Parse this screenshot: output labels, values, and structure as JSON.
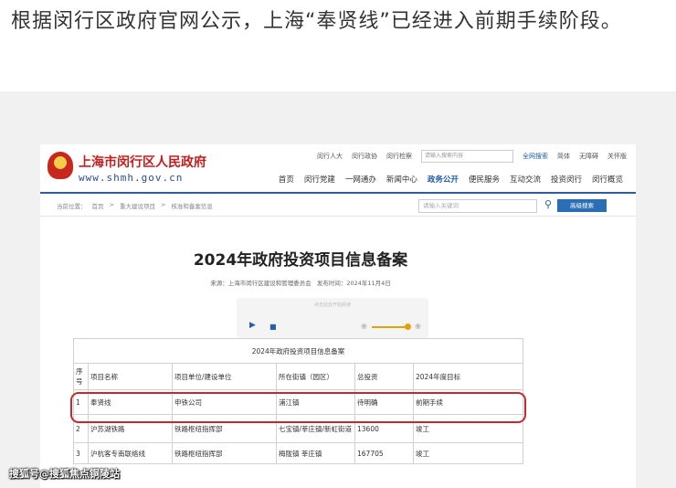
{
  "caption": "根据闵行区政府官网公示，上海“奉贤线”已经进入前期手续阶段。",
  "site": {
    "name": "上海市闵行区人民政府",
    "url": "www.shmh.gov.cn",
    "top_links": [
      "闵行人大",
      "闵行政协",
      "闵行检察"
    ],
    "top_search_label": "请输入搜索内容",
    "full_search": "全网搜索",
    "lang": "简体",
    "accessible": "无障碍",
    "care": "关怀版"
  },
  "nav": [
    "首页",
    "闵行党建",
    "一网通办",
    "新闻中心",
    "政务公开",
    "便民服务",
    "互动交流",
    "投资闵行",
    "闵行概览"
  ],
  "nav_active": "政务公开",
  "breadcrumb": [
    "当前位置：",
    "首页",
    ">",
    "重大建设项目",
    ">",
    "核准和备案信息"
  ],
  "search": {
    "placeholder": "请输入关键词",
    "button": "高级搜索"
  },
  "article": {
    "title": "2024年政府投资项目信息备案",
    "source": "来源：上海市闵行区建设和管理委员会",
    "date": "发布时间：2024年11月4日"
  },
  "player": {
    "label": "点击此处开始阅读"
  },
  "table": {
    "caption": "2024年政府投资项目信息备案",
    "headers": [
      "序号",
      "项目名称",
      "项目单位/建设单位",
      "所在街镇（园区）",
      "总投资",
      "2024年度目标"
    ],
    "rows": [
      [
        "1",
        "奉贤线",
        "申铁公司",
        "浦江镇",
        "待明确",
        "前期手续"
      ],
      [
        "2",
        "沪苏湖铁路",
        "铁路枢纽指挥部",
        "七宝镇/莘庄镇/新虹街道",
        "13600",
        "竣工"
      ],
      [
        "3",
        "沪杭客专南联络线",
        "铁路枢纽指挥部",
        "梅陇镇  莘庄镇",
        "167705",
        "竣工"
      ]
    ]
  },
  "watermark": "搜狐号@搜狐焦点铜陵站",
  "colors": {
    "highlight": "#c9272e",
    "nav_active": "#1f5aa6",
    "site_name": "#c21f1f",
    "button": "#2c6eb5"
  }
}
